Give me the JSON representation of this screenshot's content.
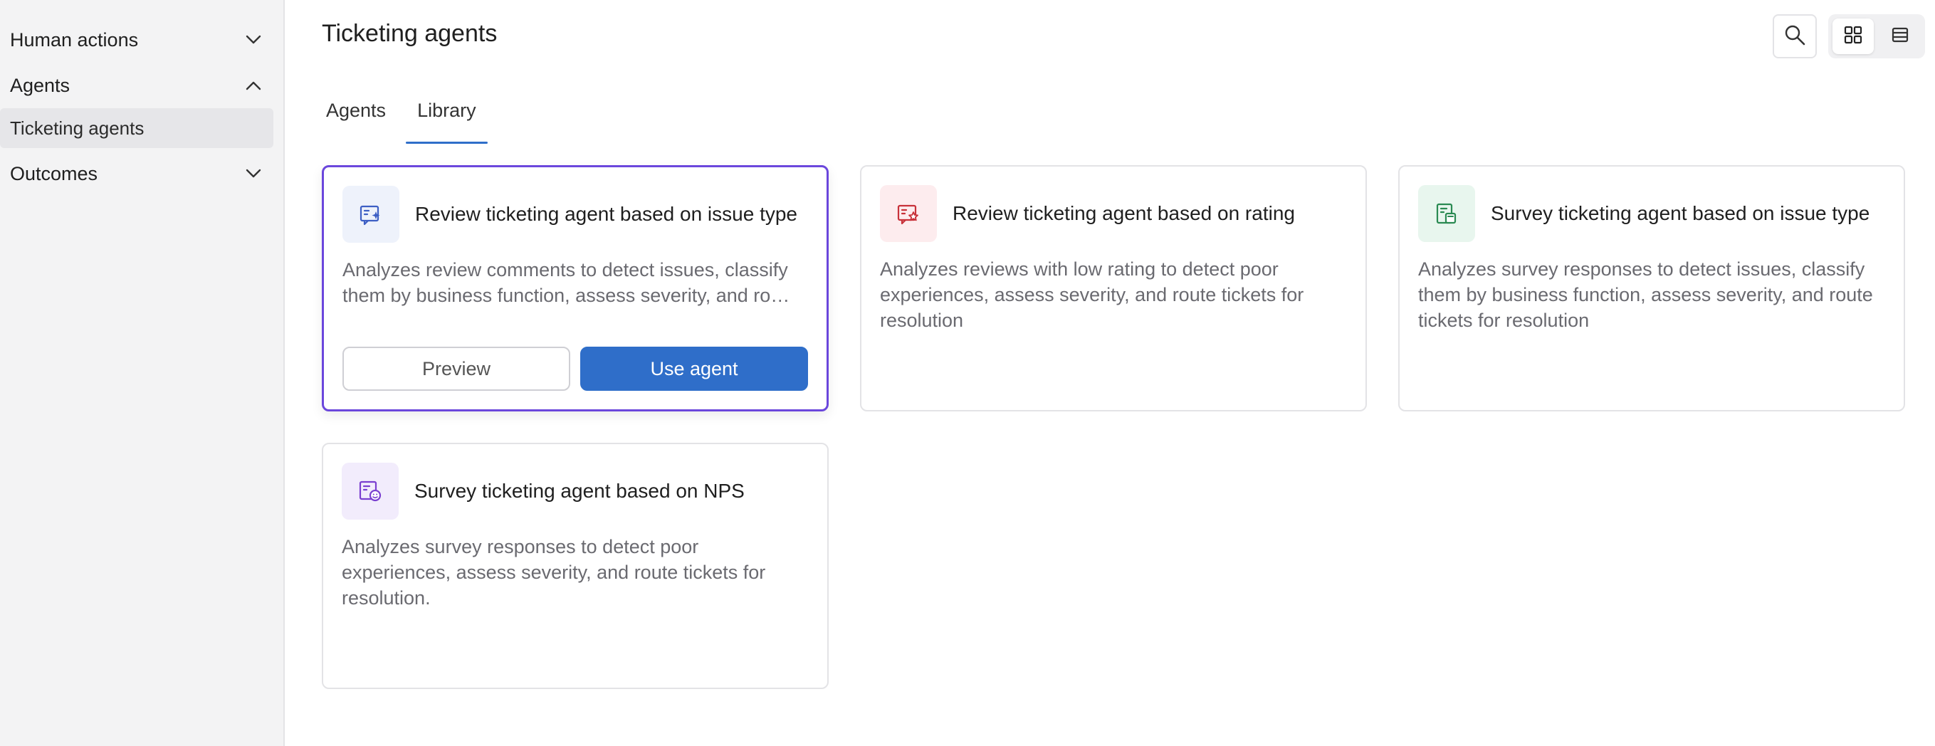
{
  "sidebar": {
    "groups": [
      {
        "label": "Human actions",
        "expanded": false
      },
      {
        "label": "Agents",
        "expanded": true,
        "items": [
          {
            "label": "Ticketing agents",
            "selected": true
          }
        ]
      },
      {
        "label": "Outcomes",
        "expanded": false
      }
    ]
  },
  "header": {
    "title": "Ticketing agents",
    "search_icon": "search-icon",
    "view_modes": [
      {
        "name": "grid-view-icon",
        "active": true
      },
      {
        "name": "list-view-icon",
        "active": false
      }
    ]
  },
  "tabs": [
    {
      "label": "Agents",
      "active": false
    },
    {
      "label": "Library",
      "active": true
    }
  ],
  "cards": [
    {
      "title": "Review ticketing agent based on issue type",
      "description": "Analyzes review comments to detect issues, classify them by business function, assess severity, and route tickets for resolution",
      "icon": "review-sparkle-icon",
      "icon_color": "#3d5fc4",
      "icon_bg": "#eef2fb",
      "selected": true,
      "preview_label": "Preview",
      "use_label": "Use agent"
    },
    {
      "title": "Review ticketing agent based on rating",
      "description": "Analyzes reviews with low rating to detect poor experiences, assess severity, and route tickets for resolution",
      "icon": "review-star-icon",
      "icon_color": "#c8323a",
      "icon_bg": "#fdecee",
      "selected": false
    },
    {
      "title": "Survey ticketing agent based on issue type",
      "description": "Analyzes survey responses to detect issues, classify them by business function, assess severity, and route tickets for resolution",
      "icon": "survey-doc-icon",
      "icon_color": "#2a8a52",
      "icon_bg": "#e8f6ee",
      "selected": false
    },
    {
      "title": "Survey ticketing agent based on NPS",
      "description": "Analyzes survey responses to detect poor experiences, assess severity, and route tickets for resolution.",
      "icon": "survey-nps-icon",
      "icon_color": "#7a3fd0",
      "icon_bg": "#f2ecfc",
      "selected": false
    }
  ],
  "colors": {
    "accent": "#2f6ec9",
    "selected_border": "#6b47dc",
    "sidebar_bg": "#f3f3f4"
  }
}
